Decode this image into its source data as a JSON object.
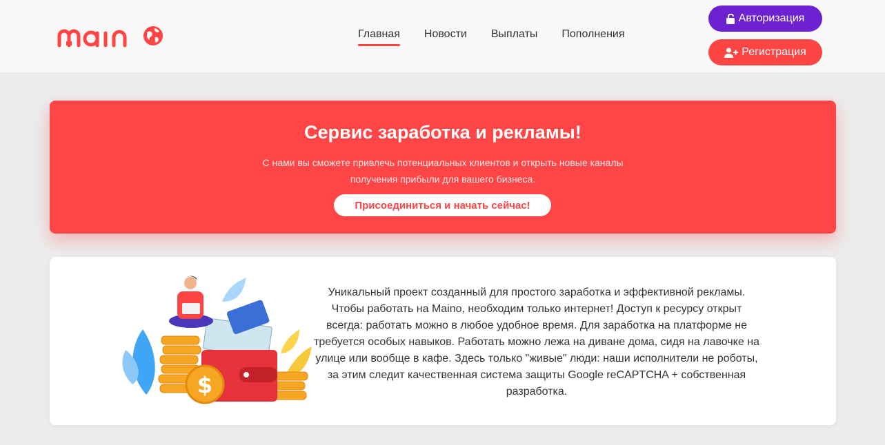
{
  "header": {
    "logo_text": "maino",
    "nav": [
      {
        "label": "Главная",
        "active": true
      },
      {
        "label": "Новости",
        "active": false
      },
      {
        "label": "Выплаты",
        "active": false
      },
      {
        "label": "Пополнения",
        "active": false
      }
    ],
    "auth_label": "Авторизация",
    "register_label": "Регистрация",
    "auth_icon": "unlock-icon",
    "register_icon": "user-plus-icon"
  },
  "hero": {
    "title": "Сервис заработка и рекламы!",
    "subtitle": "С нами вы сможете привлечь потенциальных клиентов и открыть новые каналы получения прибыли для вашего бизнеса.",
    "cta_label": "Присоединиться и начать сейчас!"
  },
  "about": {
    "text": "Уникальный проект созданный для простого заработка и эффективной рекламы. Чтобы работать на Maino, необходим только интернет! Доступ к ресурсу открыт всегда: работать можно в любое удобное время. Для заработка на платформе не требуется особых навыков. Работать можно лежа на диване дома, сидя на лавочке на улице или вообще в кафе. Здесь только \"живые\" люди: наши исполнители не роботы, за этим следит качественная система защиты Google reCAPTCHA + собственная разработка.",
    "illustration": "money-illustration"
  },
  "colors": {
    "accent": "#ff4444",
    "auth_button": "#6c22d0",
    "background": "#ececec",
    "header_bg": "#f8f8f8"
  }
}
